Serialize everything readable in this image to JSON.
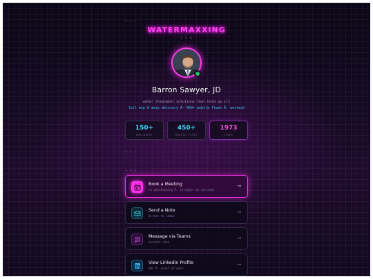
{
  "top_dots": "...",
  "brand": {
    "title": "WATERMAXXING",
    "subtitle": "1 5 8"
  },
  "profile": {
    "name": "Barron Sawyer, JD",
    "tagline": "water treatment solutions that hold up irl",
    "tagline2": "full mtp & metp delivery Â· 450+ mobile fleet Â· westech"
  },
  "stats": [
    {
      "value": "150+",
      "label": "ENGINEERS",
      "color": "#3fd4f2"
    },
    {
      "value": "450+",
      "label": "MOBILE FLEET",
      "color": "#3fd4f2"
    },
    {
      "value": "1973",
      "label": "SINCE",
      "color": "#ff4fe6"
    }
  ],
  "section_dots": [
    "...",
    "..."
  ],
  "actions": [
    {
      "title": "Book a Meeting",
      "desc": "no gatekeeping Â· straight to calendar",
      "icon": "calendar-icon",
      "arrow": "→",
      "accent": "#ff33ec"
    },
    {
      "title": "Send a Note",
      "desc": "direct to inbox",
      "icon": "mail-icon",
      "arrow": "→",
      "accent": "#35cde8"
    },
    {
      "title": "Message via Teams",
      "desc": "instant chat",
      "icon": "chat-icon",
      "arrow": "→",
      "accent": "#c04ad6"
    },
    {
      "title": "View LinkedIn Profile",
      "desc": "30+ Â· proof of work",
      "icon": "linkedin-icon",
      "arrow": "→",
      "accent": "#2fa9e6"
    }
  ]
}
